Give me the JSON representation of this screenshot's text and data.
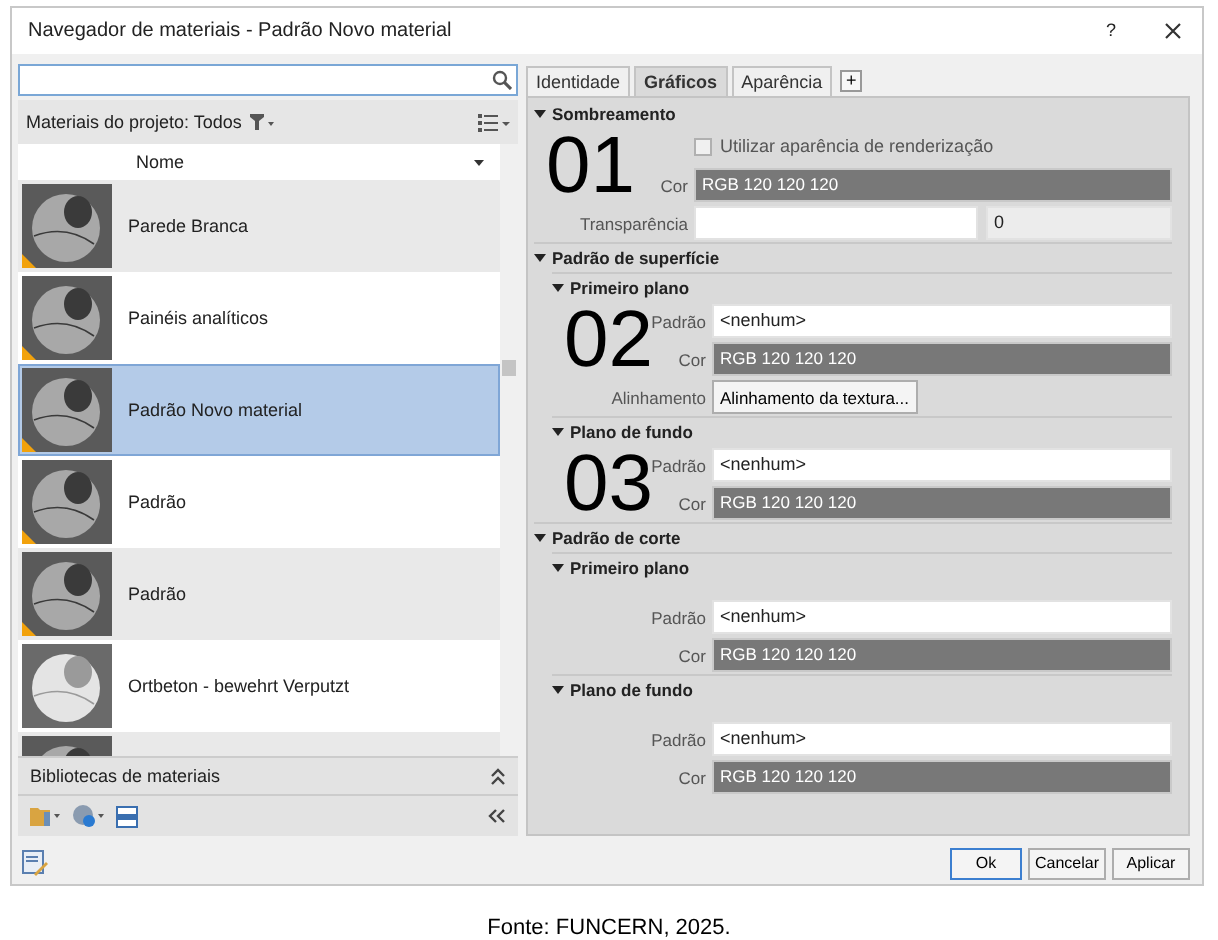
{
  "window": {
    "title": "Navegador de materiais - Padrão Novo material",
    "help": "?"
  },
  "browser": {
    "filter_label": "Materiais do projeto: Todos",
    "column": "Nome",
    "libraries_label": "Bibliotecas de materiais"
  },
  "materials": [
    {
      "name": "Parede Branca",
      "selected": false,
      "kind": "dark"
    },
    {
      "name": "Painéis analíticos",
      "selected": false,
      "kind": "dark"
    },
    {
      "name": "Padrão Novo material",
      "selected": true,
      "kind": "dark"
    },
    {
      "name": "Padrão",
      "selected": false,
      "kind": "dark"
    },
    {
      "name": "Padrão",
      "selected": false,
      "kind": "dark"
    },
    {
      "name": "Ortbeton - bewehrt Verputzt",
      "selected": false,
      "kind": "light"
    },
    {
      "selected": false,
      "kind": "dark"
    }
  ],
  "tabs": [
    {
      "label": "Identidade",
      "selected": false
    },
    {
      "label": "Gráficos",
      "selected": true
    },
    {
      "label": "Aparência",
      "selected": false
    }
  ],
  "add_tab": "+",
  "sections": [
    {
      "title": "Sombreamento",
      "expanded": true,
      "groups": [
        {
          "number": "01",
          "rows": [
            {
              "kind": "checkbox",
              "label": "Utilizar aparência de renderização",
              "checked": false
            },
            {
              "kind": "color",
              "label": "Cor",
              "value": "RGB 120 120 120"
            },
            {
              "kind": "number",
              "label": "Transparência",
              "value": "0"
            }
          ]
        }
      ]
    },
    {
      "title": "Padrão de superfície",
      "expanded": true,
      "groups": [
        {
          "title": "Primeiro plano",
          "expanded": true,
          "number": "02",
          "rows": [
            {
              "kind": "text",
              "label": "Padrão",
              "value": "<nenhum>"
            },
            {
              "kind": "color",
              "label": "Cor",
              "value": "RGB 120 120 120"
            },
            {
              "kind": "button",
              "label": "Alinhamento",
              "value": "Alinhamento da textura..."
            }
          ]
        },
        {
          "title": "Plano de fundo",
          "expanded": true,
          "number": "03",
          "rows": [
            {
              "kind": "text",
              "label": "Padrão",
              "value": "<nenhum>"
            },
            {
              "kind": "color",
              "label": "Cor",
              "value": "RGB 120 120 120"
            }
          ]
        }
      ]
    },
    {
      "title": "Padrão de corte",
      "expanded": true,
      "groups": [
        {
          "title": "Primeiro plano",
          "expanded": true,
          "rows": [
            {
              "kind": "text",
              "label": "Padrão",
              "value": "<nenhum>"
            },
            {
              "kind": "color",
              "label": "Cor",
              "value": "RGB 120 120 120"
            }
          ]
        },
        {
          "title": "Plano de fundo",
          "expanded": true,
          "rows": [
            {
              "kind": "text",
              "label": "Padrão",
              "value": "<nenhum>"
            },
            {
              "kind": "color",
              "label": "Cor",
              "value": "RGB 120 120 120"
            }
          ]
        }
      ]
    }
  ],
  "buttons": [
    {
      "label": "Ok",
      "default": true
    },
    {
      "label": "Cancelar",
      "default": false
    },
    {
      "label": "Aplicar",
      "default": false
    }
  ],
  "caption": "Fonte: FUNCERN, 2025."
}
